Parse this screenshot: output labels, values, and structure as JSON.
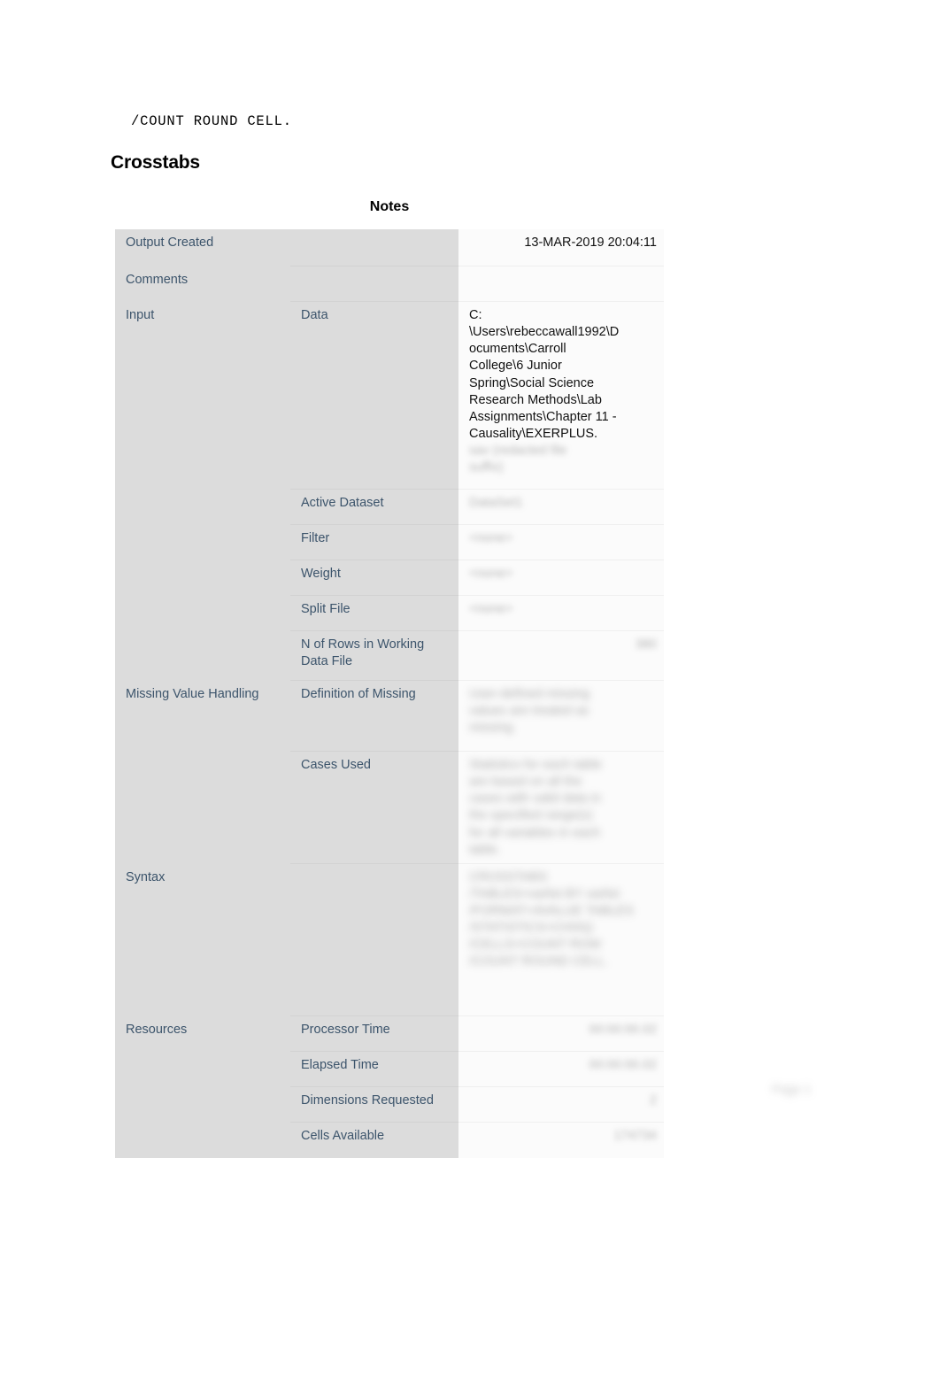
{
  "document": {
    "syntax_line": "/COUNT ROUND CELL.",
    "section_heading": "Crosstabs",
    "page_stamp": "Page 1"
  },
  "notes_table": {
    "title": "Notes",
    "rows": [
      {
        "label_a": "Output Created",
        "label_b": "",
        "value": "13-MAR-2019 20:04:11",
        "value_align": "right",
        "redacted": false
      },
      {
        "label_a": "Comments",
        "label_b": "",
        "value": "",
        "value_align": "left",
        "redacted": false
      },
      {
        "label_a": "Input",
        "label_b": "Data",
        "value": "C:\n\\Users\\rebeccawall1992\\D\nocuments\\Carroll\nCollege\\6 Junior\nSpring\\Social Science\nResearch Methods\\Lab\nAssignments\\Chapter 11 -\nCausality\\EXERPLUS.",
        "value_extra_redacted": "sav (redacted file\nsuffix)",
        "value_align": "left",
        "redacted": false
      },
      {
        "label_a": "",
        "label_b": "Active Dataset",
        "value": "DataSet1",
        "value_align": "left",
        "redacted": true
      },
      {
        "label_a": "",
        "label_b": "Filter",
        "value": "<none>",
        "value_align": "left",
        "redacted": true
      },
      {
        "label_a": "",
        "label_b": "Weight",
        "value": "<none>",
        "value_align": "left",
        "redacted": true
      },
      {
        "label_a": "",
        "label_b": "Split File",
        "value": "<none>",
        "value_align": "left",
        "redacted": true
      },
      {
        "label_a": "",
        "label_b": "N of Rows in Working Data File",
        "value": "380",
        "value_align": "right",
        "redacted": true
      },
      {
        "label_a": "Missing Value Handling",
        "label_b": "Definition of Missing",
        "value": "User-defined missing\nvalues are treated as\nmissing.",
        "value_align": "left",
        "redacted": true
      },
      {
        "label_a": "",
        "label_b": "Cases Used",
        "value": "Statistics for each table\nare based on all the\ncases with valid data in\nthe specified range(s)\nfor all variables in each\ntable.",
        "value_align": "left",
        "redacted": true
      },
      {
        "label_a": "Syntax",
        "label_b": "",
        "value": "CROSSTABS\n  /TABLES=varlist BY varlist\n  /FORMAT=AVALUE TABLES\n  /STATISTICS=CHISQ\n  /CELLS=COUNT ROW\n  /COUNT ROUND CELL.",
        "value_align": "left",
        "redacted": true
      },
      {
        "label_a": "Resources",
        "label_b": "Processor Time",
        "value": "00:00:00.02",
        "value_align": "right",
        "redacted": true
      },
      {
        "label_a": "",
        "label_b": "Elapsed Time",
        "value": "00:00:00.02",
        "value_align": "right",
        "redacted": true
      },
      {
        "label_a": "",
        "label_b": "Dimensions Requested",
        "value": "2",
        "value_align": "right",
        "redacted": true
      },
      {
        "label_a": "",
        "label_b": "Cells Available",
        "value": "174734",
        "value_align": "right",
        "redacted": true
      }
    ]
  }
}
